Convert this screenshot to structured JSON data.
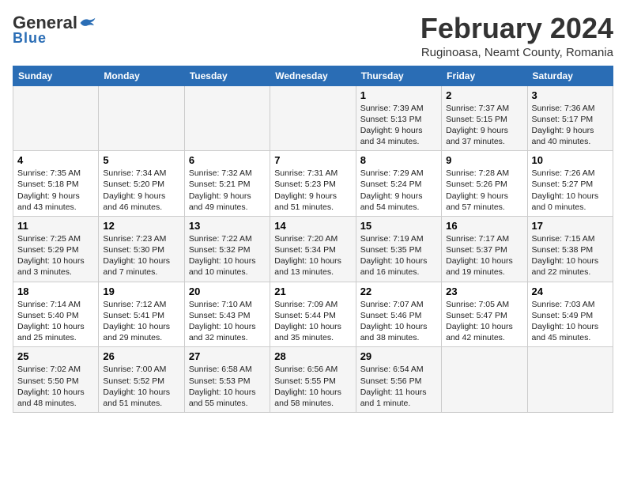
{
  "logo": {
    "general": "General",
    "blue": "Blue"
  },
  "title": "February 2024",
  "location": "Ruginoasa, Neamt County, Romania",
  "days_of_week": [
    "Sunday",
    "Monday",
    "Tuesday",
    "Wednesday",
    "Thursday",
    "Friday",
    "Saturday"
  ],
  "weeks": [
    [
      {
        "day": "",
        "info": ""
      },
      {
        "day": "",
        "info": ""
      },
      {
        "day": "",
        "info": ""
      },
      {
        "day": "",
        "info": ""
      },
      {
        "day": "1",
        "info": "Sunrise: 7:39 AM\nSunset: 5:13 PM\nDaylight: 9 hours\nand 34 minutes."
      },
      {
        "day": "2",
        "info": "Sunrise: 7:37 AM\nSunset: 5:15 PM\nDaylight: 9 hours\nand 37 minutes."
      },
      {
        "day": "3",
        "info": "Sunrise: 7:36 AM\nSunset: 5:17 PM\nDaylight: 9 hours\nand 40 minutes."
      }
    ],
    [
      {
        "day": "4",
        "info": "Sunrise: 7:35 AM\nSunset: 5:18 PM\nDaylight: 9 hours\nand 43 minutes."
      },
      {
        "day": "5",
        "info": "Sunrise: 7:34 AM\nSunset: 5:20 PM\nDaylight: 9 hours\nand 46 minutes."
      },
      {
        "day": "6",
        "info": "Sunrise: 7:32 AM\nSunset: 5:21 PM\nDaylight: 9 hours\nand 49 minutes."
      },
      {
        "day": "7",
        "info": "Sunrise: 7:31 AM\nSunset: 5:23 PM\nDaylight: 9 hours\nand 51 minutes."
      },
      {
        "day": "8",
        "info": "Sunrise: 7:29 AM\nSunset: 5:24 PM\nDaylight: 9 hours\nand 54 minutes."
      },
      {
        "day": "9",
        "info": "Sunrise: 7:28 AM\nSunset: 5:26 PM\nDaylight: 9 hours\nand 57 minutes."
      },
      {
        "day": "10",
        "info": "Sunrise: 7:26 AM\nSunset: 5:27 PM\nDaylight: 10 hours\nand 0 minutes."
      }
    ],
    [
      {
        "day": "11",
        "info": "Sunrise: 7:25 AM\nSunset: 5:29 PM\nDaylight: 10 hours\nand 3 minutes."
      },
      {
        "day": "12",
        "info": "Sunrise: 7:23 AM\nSunset: 5:30 PM\nDaylight: 10 hours\nand 7 minutes."
      },
      {
        "day": "13",
        "info": "Sunrise: 7:22 AM\nSunset: 5:32 PM\nDaylight: 10 hours\nand 10 minutes."
      },
      {
        "day": "14",
        "info": "Sunrise: 7:20 AM\nSunset: 5:34 PM\nDaylight: 10 hours\nand 13 minutes."
      },
      {
        "day": "15",
        "info": "Sunrise: 7:19 AM\nSunset: 5:35 PM\nDaylight: 10 hours\nand 16 minutes."
      },
      {
        "day": "16",
        "info": "Sunrise: 7:17 AM\nSunset: 5:37 PM\nDaylight: 10 hours\nand 19 minutes."
      },
      {
        "day": "17",
        "info": "Sunrise: 7:15 AM\nSunset: 5:38 PM\nDaylight: 10 hours\nand 22 minutes."
      }
    ],
    [
      {
        "day": "18",
        "info": "Sunrise: 7:14 AM\nSunset: 5:40 PM\nDaylight: 10 hours\nand 25 minutes."
      },
      {
        "day": "19",
        "info": "Sunrise: 7:12 AM\nSunset: 5:41 PM\nDaylight: 10 hours\nand 29 minutes."
      },
      {
        "day": "20",
        "info": "Sunrise: 7:10 AM\nSunset: 5:43 PM\nDaylight: 10 hours\nand 32 minutes."
      },
      {
        "day": "21",
        "info": "Sunrise: 7:09 AM\nSunset: 5:44 PM\nDaylight: 10 hours\nand 35 minutes."
      },
      {
        "day": "22",
        "info": "Sunrise: 7:07 AM\nSunset: 5:46 PM\nDaylight: 10 hours\nand 38 minutes."
      },
      {
        "day": "23",
        "info": "Sunrise: 7:05 AM\nSunset: 5:47 PM\nDaylight: 10 hours\nand 42 minutes."
      },
      {
        "day": "24",
        "info": "Sunrise: 7:03 AM\nSunset: 5:49 PM\nDaylight: 10 hours\nand 45 minutes."
      }
    ],
    [
      {
        "day": "25",
        "info": "Sunrise: 7:02 AM\nSunset: 5:50 PM\nDaylight: 10 hours\nand 48 minutes."
      },
      {
        "day": "26",
        "info": "Sunrise: 7:00 AM\nSunset: 5:52 PM\nDaylight: 10 hours\nand 51 minutes."
      },
      {
        "day": "27",
        "info": "Sunrise: 6:58 AM\nSunset: 5:53 PM\nDaylight: 10 hours\nand 55 minutes."
      },
      {
        "day": "28",
        "info": "Sunrise: 6:56 AM\nSunset: 5:55 PM\nDaylight: 10 hours\nand 58 minutes."
      },
      {
        "day": "29",
        "info": "Sunrise: 6:54 AM\nSunset: 5:56 PM\nDaylight: 11 hours\nand 1 minute."
      },
      {
        "day": "",
        "info": ""
      },
      {
        "day": "",
        "info": ""
      }
    ]
  ]
}
